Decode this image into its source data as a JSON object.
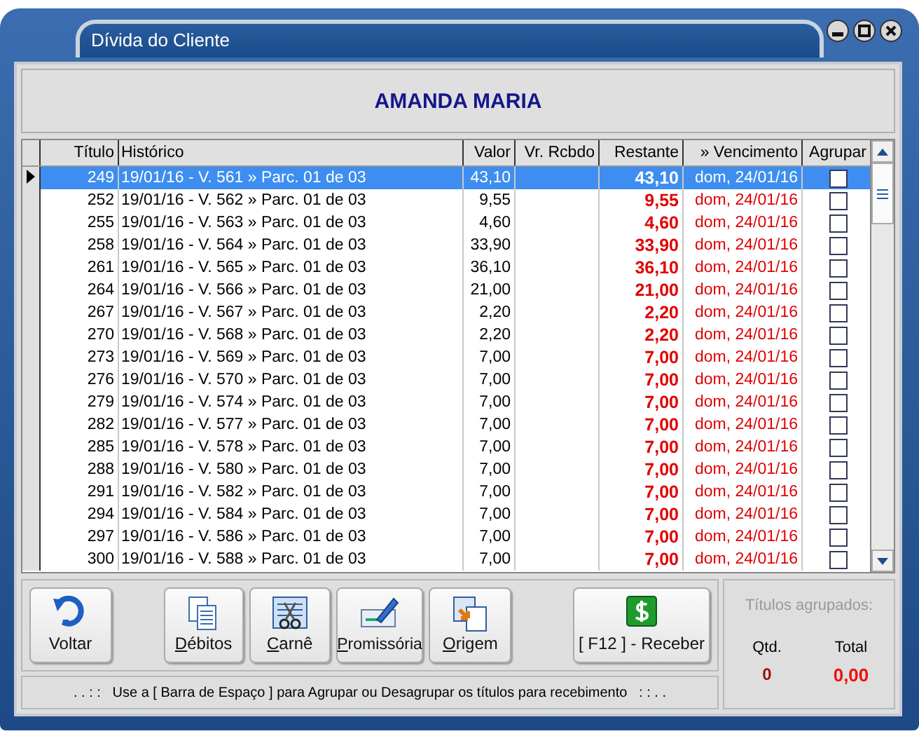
{
  "window": {
    "title": "Dívida do Cliente"
  },
  "customer": "AMANDA MARIA",
  "table": {
    "columns": [
      "Título",
      "Histórico",
      "Valor",
      "Vr. Rcbdo",
      "Restante",
      "» Vencimento",
      "Agrupar"
    ],
    "rows": [
      {
        "titulo": "249",
        "historico": "19/01/16 - V. 561 » Parc. 01 de 03",
        "valor": "43,10",
        "restante": "43,10",
        "vencimento": "dom, 24/01/16",
        "agrupar": false,
        "selected": true
      },
      {
        "titulo": "252",
        "historico": "19/01/16 - V. 562 » Parc. 01 de 03",
        "valor": "9,55",
        "restante": "9,55",
        "vencimento": "dom, 24/01/16",
        "agrupar": false,
        "selected": false
      },
      {
        "titulo": "255",
        "historico": "19/01/16 - V. 563 » Parc. 01 de 03",
        "valor": "4,60",
        "restante": "4,60",
        "vencimento": "dom, 24/01/16",
        "agrupar": false,
        "selected": false
      },
      {
        "titulo": "258",
        "historico": "19/01/16 - V. 564 » Parc. 01 de 03",
        "valor": "33,90",
        "restante": "33,90",
        "vencimento": "dom, 24/01/16",
        "agrupar": false,
        "selected": false
      },
      {
        "titulo": "261",
        "historico": "19/01/16 - V. 565 » Parc. 01 de 03",
        "valor": "36,10",
        "restante": "36,10",
        "vencimento": "dom, 24/01/16",
        "agrupar": false,
        "selected": false
      },
      {
        "titulo": "264",
        "historico": "19/01/16 - V. 566 » Parc. 01 de 03",
        "valor": "21,00",
        "restante": "21,00",
        "vencimento": "dom, 24/01/16",
        "agrupar": false,
        "selected": false
      },
      {
        "titulo": "267",
        "historico": "19/01/16 - V. 567 » Parc. 01 de 03",
        "valor": "2,20",
        "restante": "2,20",
        "vencimento": "dom, 24/01/16",
        "agrupar": false,
        "selected": false
      },
      {
        "titulo": "270",
        "historico": "19/01/16 - V. 568 » Parc. 01 de 03",
        "valor": "2,20",
        "restante": "2,20",
        "vencimento": "dom, 24/01/16",
        "agrupar": false,
        "selected": false
      },
      {
        "titulo": "273",
        "historico": "19/01/16 - V. 569 » Parc. 01 de 03",
        "valor": "7,00",
        "restante": "7,00",
        "vencimento": "dom, 24/01/16",
        "agrupar": false,
        "selected": false
      },
      {
        "titulo": "276",
        "historico": "19/01/16 - V. 570 » Parc. 01 de 03",
        "valor": "7,00",
        "restante": "7,00",
        "vencimento": "dom, 24/01/16",
        "agrupar": false,
        "selected": false
      },
      {
        "titulo": "279",
        "historico": "19/01/16 - V. 574 » Parc. 01 de 03",
        "valor": "7,00",
        "restante": "7,00",
        "vencimento": "dom, 24/01/16",
        "agrupar": false,
        "selected": false
      },
      {
        "titulo": "282",
        "historico": "19/01/16 - V. 577 » Parc. 01 de 03",
        "valor": "7,00",
        "restante": "7,00",
        "vencimento": "dom, 24/01/16",
        "agrupar": false,
        "selected": false
      },
      {
        "titulo": "285",
        "historico": "19/01/16 - V. 578 » Parc. 01 de 03",
        "valor": "7,00",
        "restante": "7,00",
        "vencimento": "dom, 24/01/16",
        "agrupar": false,
        "selected": false
      },
      {
        "titulo": "288",
        "historico": "19/01/16 - V. 580 » Parc. 01 de 03",
        "valor": "7,00",
        "restante": "7,00",
        "vencimento": "dom, 24/01/16",
        "agrupar": false,
        "selected": false
      },
      {
        "titulo": "291",
        "historico": "19/01/16 - V. 582 » Parc. 01 de 03",
        "valor": "7,00",
        "restante": "7,00",
        "vencimento": "dom, 24/01/16",
        "agrupar": false,
        "selected": false
      },
      {
        "titulo": "294",
        "historico": "19/01/16 - V. 584 » Parc. 01 de 03",
        "valor": "7,00",
        "restante": "7,00",
        "vencimento": "dom, 24/01/16",
        "agrupar": false,
        "selected": false
      },
      {
        "titulo": "297",
        "historico": "19/01/16 - V. 586 » Parc. 01 de 03",
        "valor": "7,00",
        "restante": "7,00",
        "vencimento": "dom, 24/01/16",
        "agrupar": false,
        "selected": false
      },
      {
        "titulo": "300",
        "historico": "19/01/16 - V. 588 » Parc. 01 de 03",
        "valor": "7,00",
        "restante": "7,00",
        "vencimento": "dom, 24/01/16",
        "agrupar": false,
        "selected": false
      }
    ]
  },
  "buttons": [
    {
      "kind": "voltar",
      "label": "Voltar"
    },
    {
      "kind": "debitos",
      "label": "Débitos",
      "underline_first": true
    },
    {
      "kind": "carne",
      "label": "Carnê",
      "underline_first": true
    },
    {
      "kind": "promissoria",
      "label": "Promissória",
      "underline_first": true
    },
    {
      "kind": "origem",
      "label": "Origem",
      "underline_first": true
    },
    {
      "kind": "receber",
      "label": "[ F12 ] - Receber"
    }
  ],
  "hint": ". . : :   Use a [ Barra de Espaço ] para Agrupar ou Desagrupar os títulos para recebimento   : : . .",
  "summary": {
    "title": "Títulos agrupados:",
    "qtd_label": "Qtd.",
    "qtd": "0",
    "total_label": "Total",
    "total": "0,00"
  }
}
